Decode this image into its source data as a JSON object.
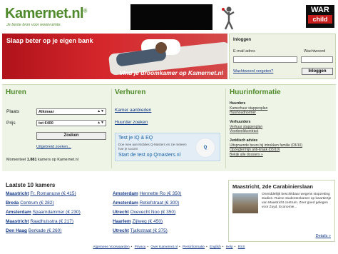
{
  "header": {
    "logo": "Kamernet.nl",
    "logo_mark": "®",
    "tagline": "Je beste bron voor woonruimte.",
    "warchild": {
      "line1": "WAR",
      "line2": "child"
    }
  },
  "banner": {
    "headline": "Slaap beter op je eigen bank",
    "cta": "Vind je droomkamer op Kamernet.nl"
  },
  "login": {
    "title": "Inloggen",
    "email_label": "E-mail adres",
    "password_label": "Wachtwoord",
    "email_value": "",
    "password_value": "",
    "forgot": "Wachtwoord vergeten?",
    "submit": "Inloggen"
  },
  "huren": {
    "title": "Huren",
    "place_label": "Plaats",
    "place_value": "Alkmaar",
    "price_label": "Prijs",
    "price_value": "tot €400",
    "search_button": "Zoeken",
    "advanced": "Uitgebreid zoeken...",
    "count_prefix": "Momenteel",
    "count": "1.881",
    "count_suffix": "kamers op Kamernet.nl"
  },
  "verhuren": {
    "title": "Verhuren",
    "offer_link": "Kamer aanbieden",
    "find_link": "Huurder zoeken",
    "iq": {
      "heading": "Test je IQ & EQ",
      "body": "Doe mee aan Mobiles Q-Masters en zie meteen hoe je scoort!",
      "cta": "Start de test op Qmasters.nl",
      "badge": "Q"
    }
  },
  "info": {
    "title": "Huurinformatie",
    "groups": [
      {
        "heading": "Huurders",
        "links": [
          "Kamerhuur stappenplan",
          "Huishoudnormer"
        ]
      },
      {
        "heading": "Verhuurders",
        "links": [
          "Verhuur stappenplan",
          "Voorbeeldcontract"
        ]
      },
      {
        "heading": "Juridisch advies",
        "links": [
          "Uitspraende beurs bij intrekken familie (03/10)",
          "Opzegtermijn anti-kraak (03/10)",
          "Bekijk alle dossiers »"
        ]
      }
    ]
  },
  "latest": {
    "title": "Laatste 10 kamers",
    "left": [
      {
        "city": "Maastricht",
        "addr": "Fr. Romanusw (€ 415)"
      },
      {
        "city": "Breda",
        "addr": "Centrum (€ 282)"
      },
      {
        "city": "Amsterdam",
        "addr": "Spaarndammer (€ 230)"
      },
      {
        "city": "Maastricht",
        "addr": "Raadhuisstra (€ 217)"
      },
      {
        "city": "Den Haag",
        "addr": "Berkade (€ 260)"
      }
    ],
    "right": [
      {
        "city": "Amsterdam",
        "addr": "Hennette Ro (€ 350)"
      },
      {
        "city": "Amsterdam",
        "addr": "Retiefstraat (€ 300)"
      },
      {
        "city": "Utrecht",
        "addr": "Ovevecht Noo (€ 350)"
      },
      {
        "city": "Haarlem",
        "addr": "Zijlweg (€ 450)"
      },
      {
        "city": "Utrecht",
        "addr": "Tjalkstraat (€ 375)"
      }
    ]
  },
  "featured": {
    "title": "Maastricht, 2de Carabinierslaan",
    "description": "Onmiddellijk beschikbaar wegens stopzetting studies. Ruime studentenkamer op kwartiertje van Maastricht centrum. Zeer goed gelegen voor Zuyd, Economie...",
    "more": "Details »"
  },
  "footer": {
    "links": [
      "Algemene Voorwaarden",
      "Privacy",
      "Over Kamernet.nl",
      "Persinformatie",
      "English",
      "Help",
      "RSS"
    ]
  }
}
